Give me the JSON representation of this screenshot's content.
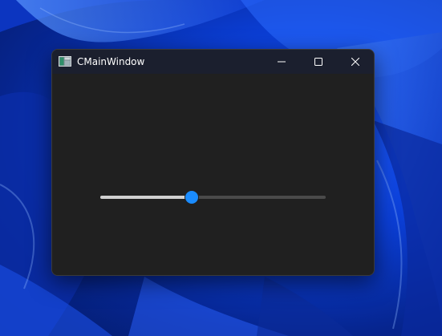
{
  "window": {
    "title": "CMainWindow",
    "icon": "app-window-icon",
    "buttons": {
      "minimize_icon": "minimize-icon",
      "maximize_icon": "maximize-icon",
      "close_icon": "close-icon"
    }
  },
  "slider": {
    "value_fraction": 0.405
  },
  "colors": {
    "accent": "#1a8cff",
    "window_bg": "#202020",
    "titlebar_bg": "#1b1f2e",
    "track": "#4a4a4a",
    "track_fill": "#d0d0d0"
  }
}
